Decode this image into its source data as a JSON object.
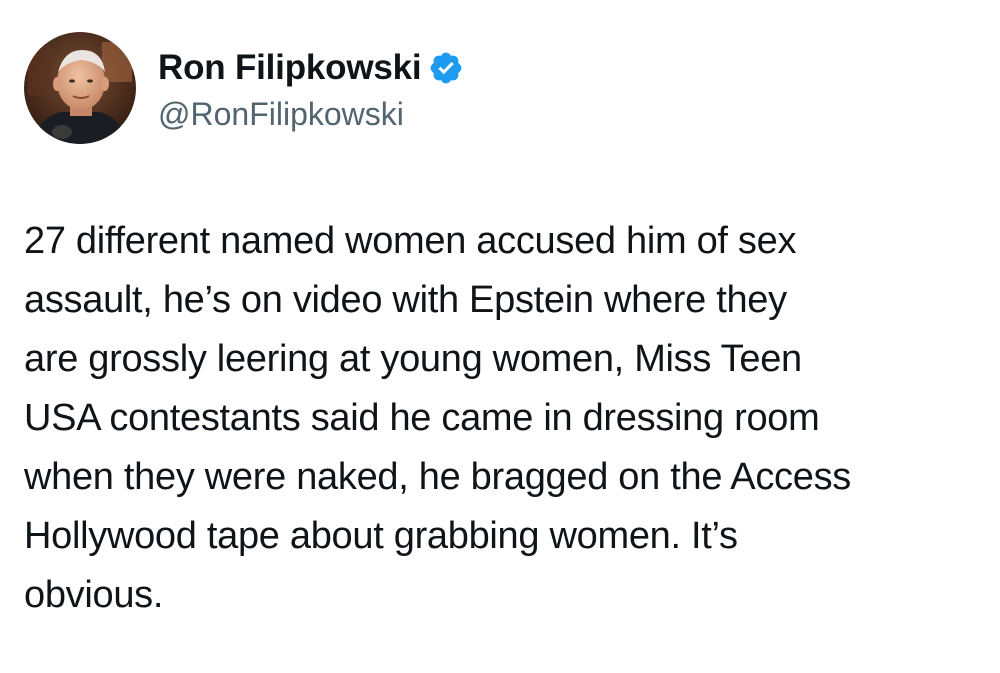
{
  "author": {
    "display_name": "Ron Filipkowski",
    "handle": "@RonFilipkowski",
    "verified": true,
    "verified_icon": "verified-badge-icon",
    "verified_color": "#1d9bf0"
  },
  "tweet": {
    "lines": [
      "27 different named women accused him of sex",
      "assault, he’s on video with Epstein where they",
      "are grossly leering at young women, Miss Teen",
      "USA contestants said he came in dressing room",
      "when they were naked, he bragged on the Access",
      "Hollywood tape about grabbing women. It’s",
      "obvious."
    ]
  },
  "colors": {
    "text_primary": "#0f1419",
    "text_secondary": "#536471",
    "background": "#ffffff"
  }
}
